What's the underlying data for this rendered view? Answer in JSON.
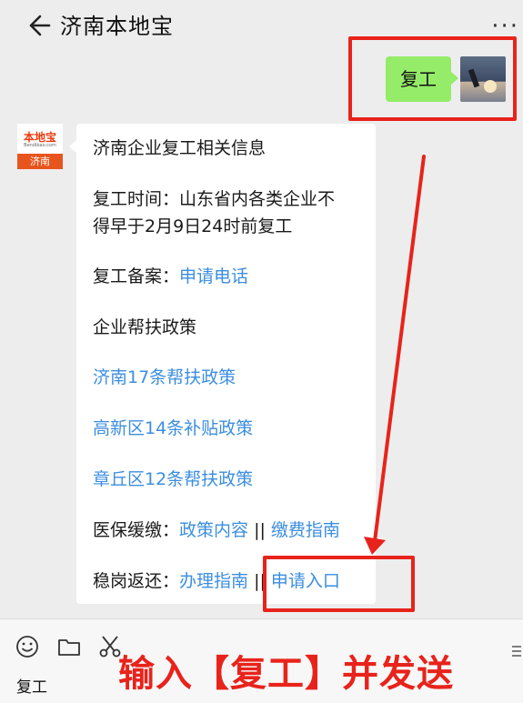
{
  "header": {
    "title": "济南本地宝",
    "more_icon": "more-icon",
    "back_icon": "back-arrow-icon"
  },
  "user_message": {
    "text": "复工"
  },
  "bot_avatar": {
    "logo_text": "本地宝",
    "logo_url": "Bendibao.com",
    "city": "济南"
  },
  "bot_message": {
    "title": "济南企业复工相关信息",
    "resume_time_line1": "复工时间：山东省内各类企业不",
    "resume_time_line2": "得早于2月9日24时前复工",
    "filing_label": "复工备案：",
    "filing_link": "申请电话",
    "policy_heading": "企业帮扶政策",
    "policy_link_1": "济南17条帮扶政策",
    "policy_link_2": "高新区14条补贴政策",
    "policy_link_3": "章丘区12条帮扶政策",
    "insurance_label": "医保缓缴：",
    "insurance_link_1": "政策内容",
    "insurance_sep": " || ",
    "insurance_link_2": "缴费指南",
    "return_label": "稳岗返还：",
    "return_link_1": "办理指南",
    "return_sep": " || ",
    "return_link_2": "申请入口"
  },
  "footer": {
    "label": "复工",
    "icons": [
      "smile-icon",
      "folder-icon",
      "scissors-icon",
      "menu-icon"
    ]
  },
  "annotation": {
    "caption": "输入【复工】并发送",
    "color": "#e8231b"
  },
  "colors": {
    "link": "#3b8ee0",
    "user_bubble": "#95ec69",
    "background": "#ededed"
  }
}
